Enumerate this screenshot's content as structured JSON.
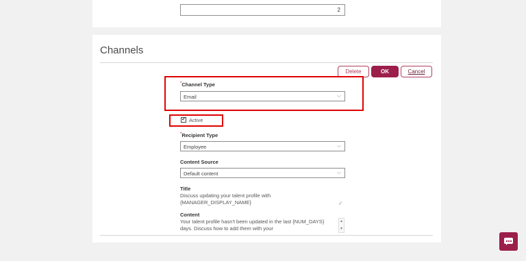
{
  "top_panel": {
    "quantity_value": "2"
  },
  "section": {
    "title": "Channels"
  },
  "buttons": {
    "delete": "Delete",
    "ok": "OK",
    "cancel": "Cancel"
  },
  "form": {
    "required_marker": "*",
    "channel_type": {
      "label": "Channel Type",
      "value": "Email"
    },
    "active": {
      "label": "Active",
      "checked": true
    },
    "recipient_type": {
      "label": "Recipient Type",
      "value": "Employee"
    },
    "content_source": {
      "label": "Content Source",
      "value": "Default content"
    },
    "title": {
      "label": "Title",
      "value": "Discuss updating your talent profile with {MANAGER_DISPLAY_NAME}"
    },
    "content": {
      "label": "Content",
      "value": "Your talent profile hasn't been updated in the last {NUM_DAYS} days. Discuss how to add them with your"
    }
  },
  "icons": {
    "checkmark": "✔",
    "chevron": "⌵",
    "chat": "chat-icon"
  },
  "colors": {
    "accent": "#9c1e4a",
    "highlight": "#e00000"
  }
}
